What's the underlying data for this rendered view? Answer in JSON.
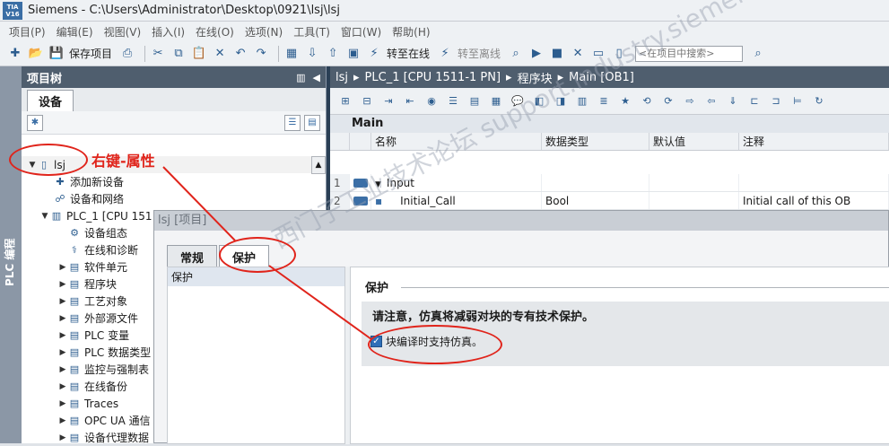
{
  "window": {
    "logo_text": "TIA V16",
    "title": "Siemens - C:\\Users\\Administrator\\Desktop\\0921\\lsj\\lsj"
  },
  "menu": [
    "项目(P)",
    "编辑(E)",
    "视图(V)",
    "插入(I)",
    "在线(O)",
    "选项(N)",
    "工具(T)",
    "窗口(W)",
    "帮助(H)"
  ],
  "toolbar": {
    "save_project": "保存项目",
    "go_online": "转至在线",
    "go_offline": "转至离线",
    "search_placeholder": "<在项目中搜索>"
  },
  "left_strip": {
    "label": "PLC 编程"
  },
  "project_tree": {
    "header": "项目树",
    "tab": "设备",
    "items": [
      {
        "label": "lsj",
        "icon": "project-icon",
        "expanded": true
      },
      {
        "label": "添加新设备",
        "icon": "add-device-icon"
      },
      {
        "label": "设备和网络",
        "icon": "network-icon"
      },
      {
        "label": "PLC_1 [CPU 151",
        "icon": "plc-icon",
        "expanded": true
      },
      {
        "label": "设备组态",
        "icon": "device-config-icon"
      },
      {
        "label": "在线和诊断",
        "icon": "diagnostics-icon"
      },
      {
        "label": "软件单元",
        "icon": "folder-icon"
      },
      {
        "label": "程序块",
        "icon": "folder-icon"
      },
      {
        "label": "工艺对象",
        "icon": "folder-icon"
      },
      {
        "label": "外部源文件",
        "icon": "folder-icon"
      },
      {
        "label": "PLC 变量",
        "icon": "folder-icon"
      },
      {
        "label": "PLC 数据类型",
        "icon": "folder-icon"
      },
      {
        "label": "监控与强制表",
        "icon": "folder-icon"
      },
      {
        "label": "在线备份",
        "icon": "folder-icon"
      },
      {
        "label": "Traces",
        "icon": "folder-icon"
      },
      {
        "label": "OPC UA 通信",
        "icon": "folder-icon"
      },
      {
        "label": "设备代理数据",
        "icon": "folder-icon"
      }
    ]
  },
  "editor": {
    "breadcrumb": [
      "lsj",
      "PLC_1 [CPU 1511-1 PN]",
      "程序块",
      "Main [OB1]"
    ],
    "block_name": "Main",
    "columns": [
      "名称",
      "数据类型",
      "默认值",
      "注释"
    ],
    "rows": [
      {
        "num": "1",
        "name": "Input",
        "type": "",
        "default": "",
        "comment": ""
      },
      {
        "num": "2",
        "name": "Initial_Call",
        "type": "Bool",
        "default": "",
        "comment": "Initial call of this OB"
      }
    ]
  },
  "properties_dialog": {
    "title": "lsj [项目]",
    "tabs": [
      "常规",
      "保护"
    ],
    "nav_item": "保护",
    "section_title": "保护",
    "notice": "请注意，仿真将减弱对块的专有技术保护。",
    "checkbox_label": "块编译时支持仿真。",
    "checkbox_checked": true
  },
  "annotation": {
    "text": "右键-属性",
    "color": "#e0241b"
  },
  "watermark": "西门子工业技术论坛 support.industry.siemens.com"
}
